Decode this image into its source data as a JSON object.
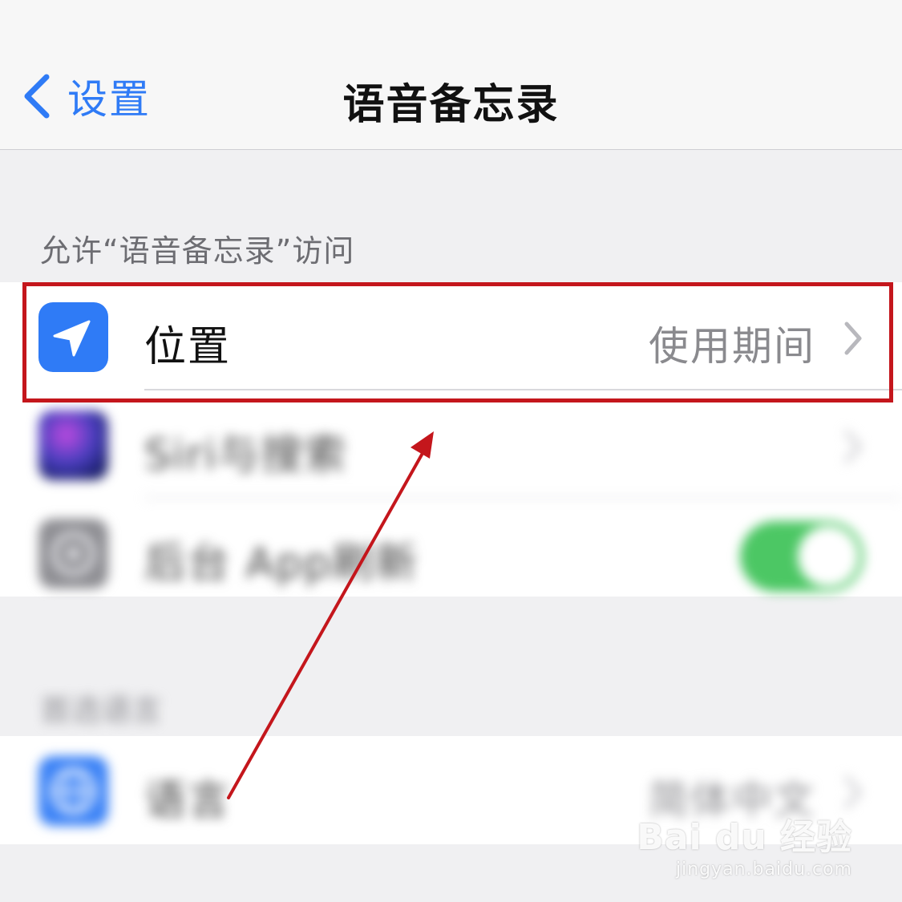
{
  "navbar": {
    "back_label": "设置",
    "title": "语音备忘录"
  },
  "section_allow": {
    "header": "允许“语音备忘录”访问",
    "rows": [
      {
        "label": "位置",
        "value": "使用期间",
        "icon": "location-arrow-icon",
        "icon_color": "#2f7bf6"
      },
      {
        "label": "Siri与搜索",
        "icon": "siri-icon"
      },
      {
        "label": "后台 App刷新",
        "icon": "gear-icon",
        "toggle_on": true,
        "toggle_color": "#4cc764"
      }
    ]
  },
  "section_language": {
    "header": "首选语言",
    "rows": [
      {
        "label": "语言",
        "value": "简体中文",
        "icon": "globe-icon",
        "icon_color": "#3b82f6"
      }
    ]
  },
  "watermark": {
    "logo": "Bai du 经验",
    "url": "jingyan.baidu.com"
  },
  "colors": {
    "accent": "#2f7bf6",
    "annotation": "#c4161c"
  }
}
